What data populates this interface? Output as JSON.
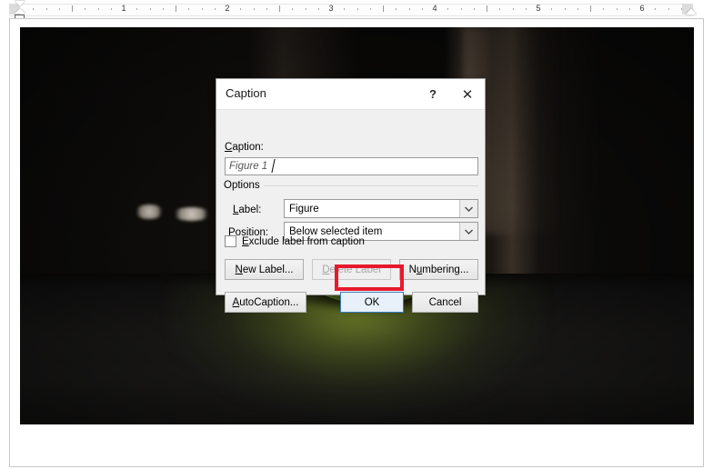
{
  "ruler": {
    "unit_labels": [
      "1",
      "2",
      "3",
      "4",
      "5",
      "6"
    ],
    "first_line_indent_marker": "first-line-indent-marker",
    "hanging_indent_marker": "hanging-indent-marker",
    "left_indent_marker": "left-indent-marker",
    "right_indent_marker": "right-indent-marker"
  },
  "document": {
    "image_alt": "green ball on dark reflective floor"
  },
  "dialog": {
    "title": "Caption",
    "help_glyph": "?",
    "close_glyph": "✕",
    "caption_label": "Caption:",
    "caption_label_accel": "C",
    "caption_value": "Figure 1",
    "options_group_label": "Options",
    "label_field_label": "Label:",
    "label_field_accel": "L",
    "label_value": "Figure",
    "position_field_label": "Position:",
    "position_field_accel": "P",
    "position_value": "Below selected item",
    "exclude_checkbox_label": "Exclude label from caption",
    "exclude_checkbox_accel": "E",
    "exclude_checked": false,
    "new_label_button": "New Label...",
    "new_label_accel": "N",
    "delete_label_button": "Delete Label",
    "delete_label_accel": "D",
    "delete_label_disabled": true,
    "numbering_button": "Numbering...",
    "numbering_accel": "N",
    "autocaption_button": "AutoCaption...",
    "autocaption_accel": "A",
    "ok_button": "OK",
    "cancel_button": "Cancel"
  },
  "annotation": {
    "highlight_target": "ok-button",
    "color": "#e8192c"
  }
}
